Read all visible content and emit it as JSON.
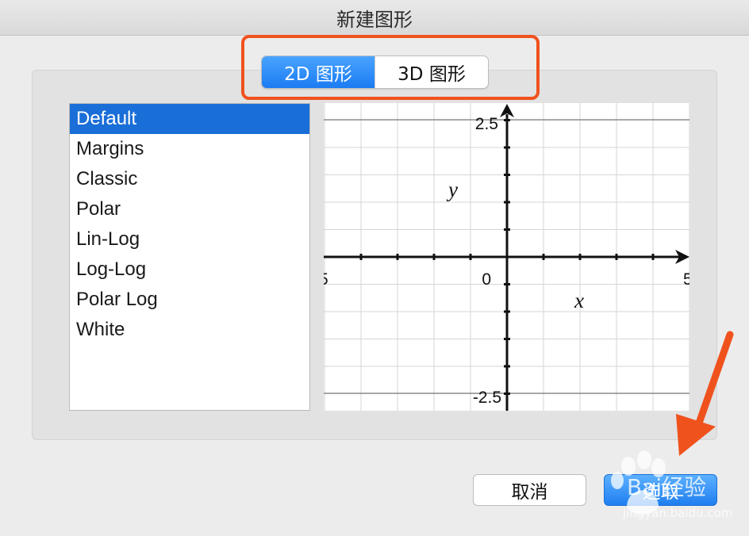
{
  "window": {
    "title": "新建图形"
  },
  "tabs": [
    {
      "label": "2D 图形",
      "active": true
    },
    {
      "label": "3D 图形",
      "active": false
    }
  ],
  "styles": {
    "items": [
      "Default",
      "Margins",
      "Classic",
      "Polar",
      "Lin-Log",
      "Log-Log",
      "Polar Log",
      "White"
    ],
    "selected": "Default"
  },
  "preview": {
    "x_label": "x",
    "y_label": "y",
    "origin_label": "0",
    "y_top_label": "2.5",
    "y_bottom_label": "-2.5",
    "x_left_label": "5",
    "x_right_label": "5"
  },
  "buttons": {
    "cancel": "取消",
    "ok": "选取"
  },
  "annotation": {
    "color": "#f0521e"
  },
  "watermark": {
    "text": "Bai经验",
    "url": "jingyan.baidu.com"
  }
}
